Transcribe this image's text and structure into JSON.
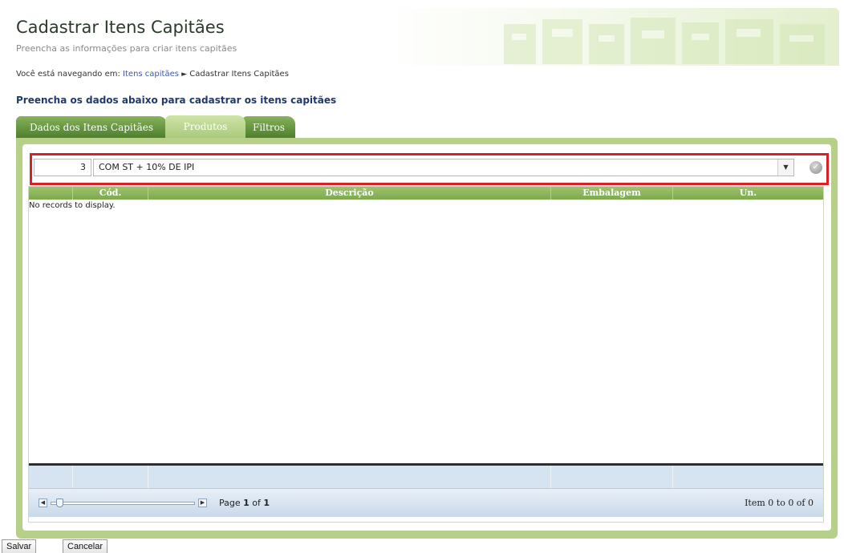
{
  "header": {
    "title": "Cadastrar Itens Capitães",
    "subtitle": "Preencha as informações para criar itens capitães"
  },
  "breadcrumb": {
    "prefix": "Você está navegando em:",
    "link": "Itens capitães",
    "current": "Cadastrar Itens Capitães"
  },
  "section_title": "Preencha os dados abaixo para cadastrar os itens capitães",
  "tabs": [
    {
      "label": "Dados dos Itens Capitães",
      "active": false
    },
    {
      "label": "Produtos",
      "active": true
    },
    {
      "label": "Filtros",
      "active": false
    }
  ],
  "product_selector": {
    "code_value": "3",
    "description_value": "COM ST + 10% DE IPI",
    "highlight_color": "#d92026"
  },
  "grid": {
    "columns": [
      "Cód.",
      "Descrição",
      "Embalagem",
      "Un."
    ],
    "empty_message": "No records to display."
  },
  "pager": {
    "page_prefix": "Page",
    "page_current": "1",
    "page_of": "of",
    "page_total": "1",
    "item_range": "Item 0 to 0 of 0"
  },
  "actions": {
    "save_label": "Salvar",
    "cancel_label": "Cancelar"
  },
  "colors": {
    "accent_green": "#4c7d2c",
    "header_green": "#9cc46d",
    "title_blue": "#1f3a6b"
  }
}
